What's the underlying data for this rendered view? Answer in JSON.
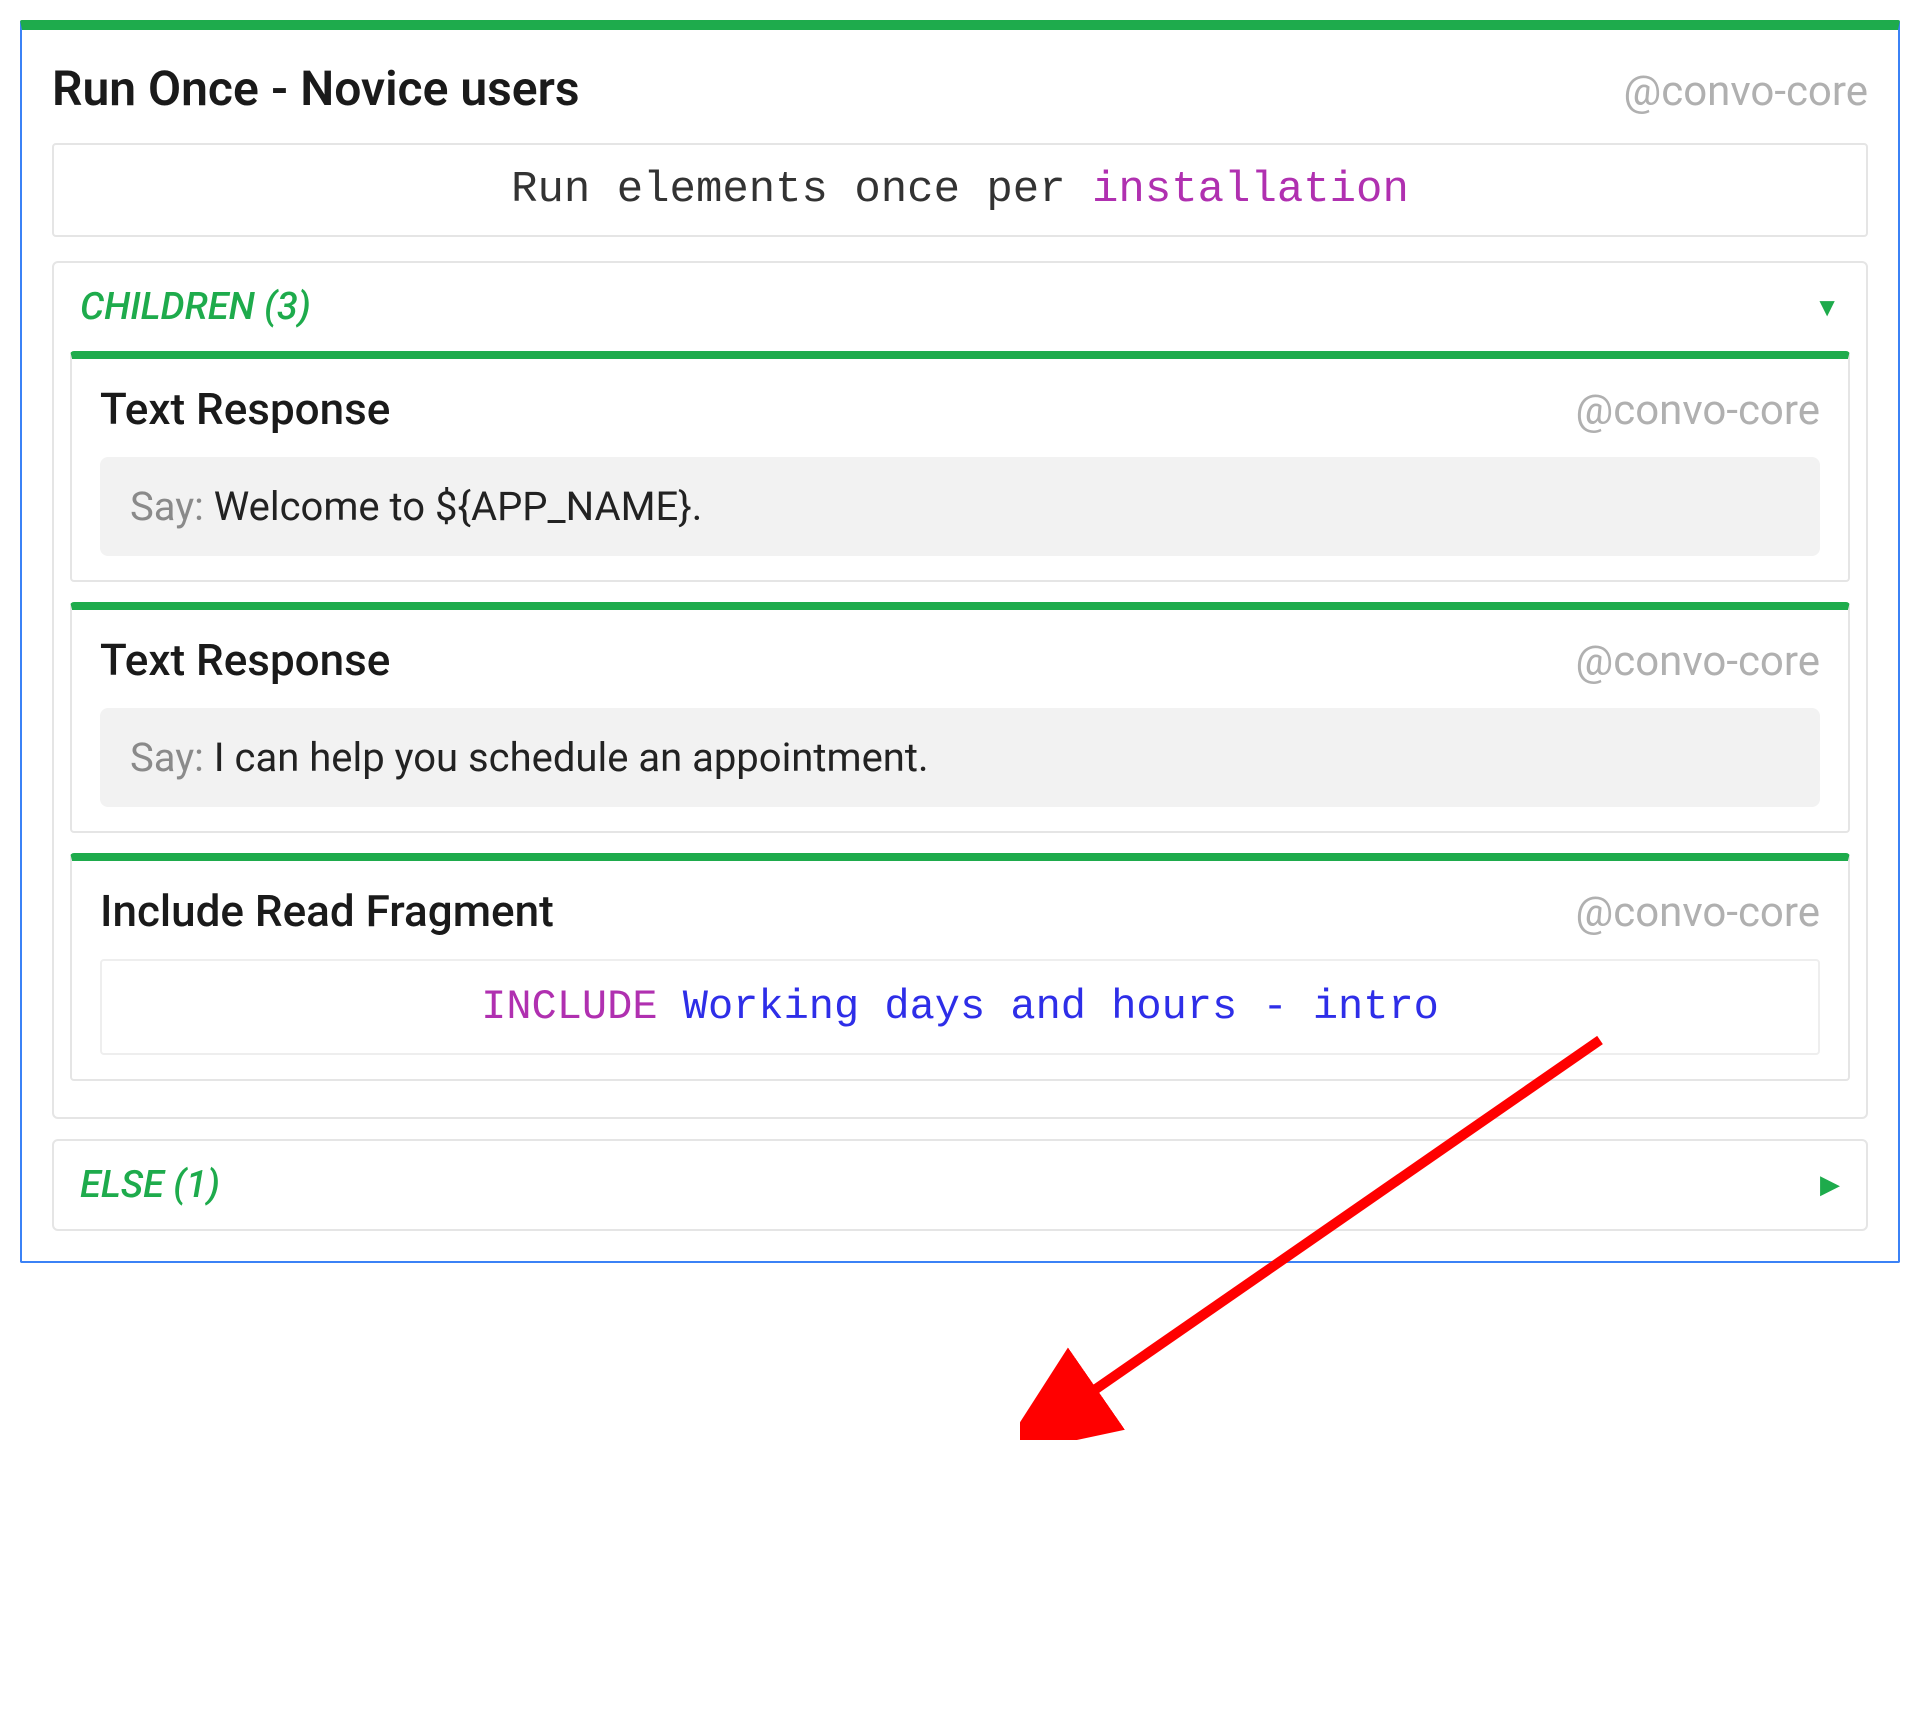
{
  "main": {
    "title": "Run Once - Novice users",
    "handle": "@convo-core",
    "run_prefix": "Run elements once per ",
    "run_keyword": "installation"
  },
  "children": {
    "label": "CHILDREN (3)",
    "items": [
      {
        "title": "Text Response",
        "handle": "@convo-core",
        "say_prefix": "Say: ",
        "say_text": "Welcome to ${APP_NAME}."
      },
      {
        "title": "Text Response",
        "handle": "@convo-core",
        "say_prefix": "Say: ",
        "say_text": "I can help you schedule an appointment."
      },
      {
        "title": "Include Read Fragment",
        "handle": "@convo-core",
        "include_kw": "INCLUDE ",
        "include_name": "Working days and hours - intro"
      }
    ]
  },
  "else": {
    "label": "ELSE (1)"
  }
}
